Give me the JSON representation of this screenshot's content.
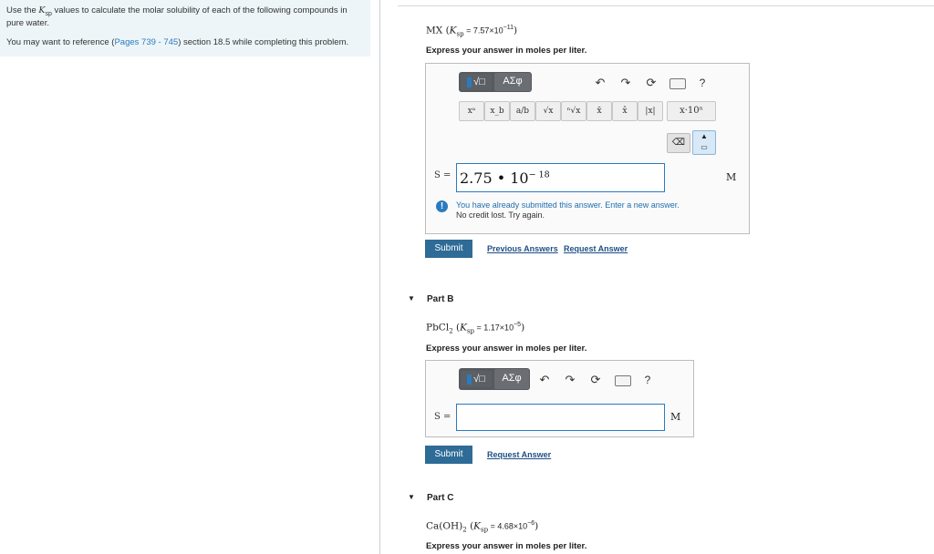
{
  "instructions": {
    "line1_a": "Use the ",
    "ksp_K": "K",
    "ksp_sub": "sp",
    "line1_b": " values to calculate the molar solubility of each of the following compounds in",
    "line2": "pure water.",
    "ref_a": "You may want to reference (",
    "ref_link": "Pages 739 - 745",
    "ref_b": ") section 18.5 while completing this problem."
  },
  "partA": {
    "formula": "MX",
    "ksp_prefix": " (",
    "ksp_K": "K",
    "ksp_sub": "sp",
    "ksp_eq": " = 7.57×10",
    "ksp_exp": "−11",
    "ksp_close": ")",
    "prompt": "Express your answer in moles per liter.",
    "var_label": "S =",
    "answer_mantissa": "2.75 • 10",
    "answer_exp": "− 18",
    "unit": "M",
    "feedback_line1": "You have already submitted this answer. Enter a new answer.",
    "feedback_line2": "No credit lost. Try again.",
    "submit_label": "Submit",
    "prev_answers_label": "Previous Answers",
    "request_answer_label": "Request Answer",
    "toolbar": {
      "template_label": "√□",
      "greek_label": "ΑΣφ",
      "help_label": "?",
      "sci_label": "x·10ⁿ",
      "symbols": [
        "xᵃ",
        "x_b",
        "a/b",
        "√x",
        "ⁿ√x",
        "x̄",
        "x̂",
        "|x|"
      ]
    }
  },
  "partB": {
    "toggle": "▼",
    "title": "Part B",
    "formula_a": "PbCl",
    "formula_sub": "2",
    "ksp_prefix": " (",
    "ksp_K": "K",
    "ksp_sub": "sp",
    "ksp_eq": " = 1.17×10",
    "ksp_exp": "−5",
    "ksp_close": ")",
    "prompt": "Express your answer in moles per liter.",
    "var_label": "S =",
    "unit": "M",
    "submit_label": "Submit",
    "request_answer_label": "Request Answer",
    "toolbar": {
      "template_label": "√□",
      "greek_label": "ΑΣφ",
      "help_label": "?"
    }
  },
  "partC": {
    "toggle": "▼",
    "title": "Part C",
    "formula_a": "Ca(OH)",
    "formula_sub": "2",
    "ksp_prefix": " (",
    "ksp_K": "K",
    "ksp_sub": "sp",
    "ksp_eq": " = 4.68×10",
    "ksp_exp": "−6",
    "ksp_close": ")",
    "prompt": "Express your answer in moles per liter."
  }
}
